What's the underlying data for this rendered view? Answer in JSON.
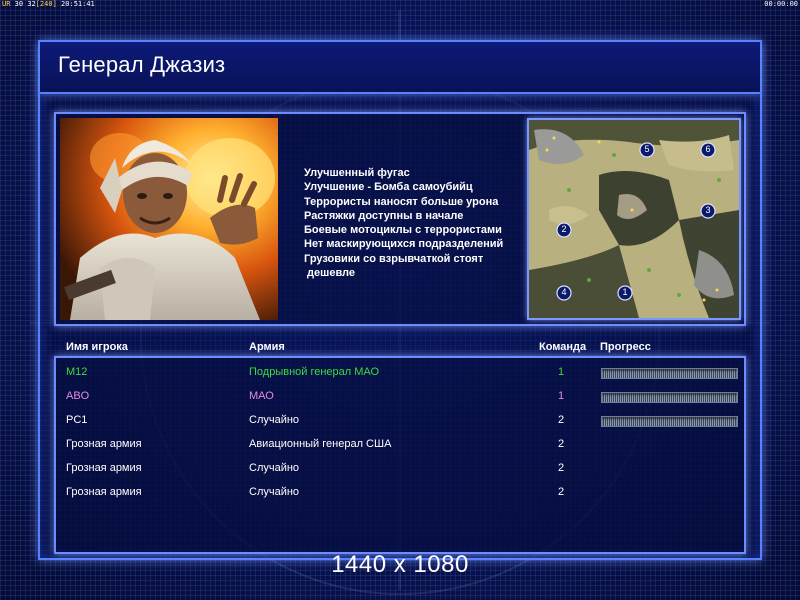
{
  "hud": {
    "ur_label": "UR",
    "fps": "30",
    "fps2": "32",
    "frame": "[240]",
    "clock": "20:51:41",
    "timer": "00:00:00"
  },
  "title": "Генерал Джазиз",
  "general_notes": [
    "Улучшенный фугас",
    "Улучшение - Бомба самоубийц",
    "Террористы наносят больше урона",
    "Растяжки доступны в начале",
    "Боевые мотоциклы с террористами",
    "Нет маскирующихся подразделений",
    "Грузовики со взрывчаткой стоят",
    " дешевле"
  ],
  "map": {
    "start_positions": [
      "1",
      "2",
      "3",
      "4",
      "5",
      "6"
    ]
  },
  "table": {
    "headers": {
      "player": "Имя игрока",
      "army": "Армия",
      "team": "Команда",
      "progress": "Прогресс"
    },
    "rows": [
      {
        "name": "M12",
        "army": "Подрывной генерал МАО",
        "team": "1",
        "color": "#3cdc3c",
        "progress": 1.0
      },
      {
        "name": "ABO",
        "army": "МАО",
        "team": "1",
        "color": "#e08ae6",
        "progress": 1.0
      },
      {
        "name": "PC1",
        "army": "Случайно",
        "team": "2",
        "color": "#ffffff",
        "progress": 1.0
      },
      {
        "name": "Грозная армия",
        "army": "Авиационный генерал США",
        "team": "2",
        "color": "#ffffff",
        "progress": null
      },
      {
        "name": "Грозная армия",
        "army": "Случайно",
        "team": "2",
        "color": "#ffffff",
        "progress": null
      },
      {
        "name": "Грозная армия",
        "army": "Случайно",
        "team": "2",
        "color": "#ffffff",
        "progress": null
      }
    ]
  },
  "resolution_label": "1440 x 1080",
  "colors": {
    "frame_glow": "#5a7fff",
    "background": "#0a1456"
  }
}
